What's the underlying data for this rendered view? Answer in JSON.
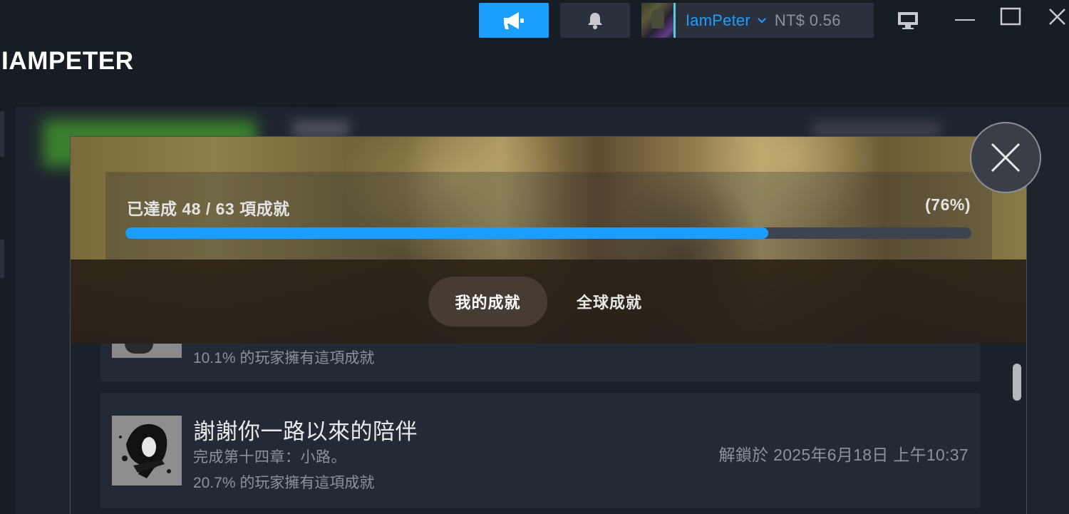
{
  "topbar": {
    "announce_icon": "megaphone-icon",
    "notification_icon": "bell-icon",
    "account": {
      "username": "IamPeter",
      "wallet": "NT$ 0.56"
    },
    "colors": {
      "accent": "#1a9fff",
      "username": "#1a9fff"
    }
  },
  "page": {
    "title": "IAMPETER"
  },
  "achievements": {
    "progress_label": "已達成 48 / 63 項成就",
    "progress_percent_label": "(76%)",
    "achieved": 48,
    "total": 63,
    "progress_fraction": 0.76,
    "tabs": [
      {
        "label": "我的成就",
        "selected": true
      },
      {
        "label": "全球成就",
        "selected": false
      }
    ],
    "items": [
      {
        "rate": "10.1% 的玩家擁有這項成就"
      },
      {
        "title": "謝謝你一路以來的陪伴",
        "description": "完成第十四章：小路。",
        "rate": "20.7% 的玩家擁有這項成就",
        "unlocked": "解鎖於 2025年6月18日 上午10:37"
      }
    ]
  }
}
